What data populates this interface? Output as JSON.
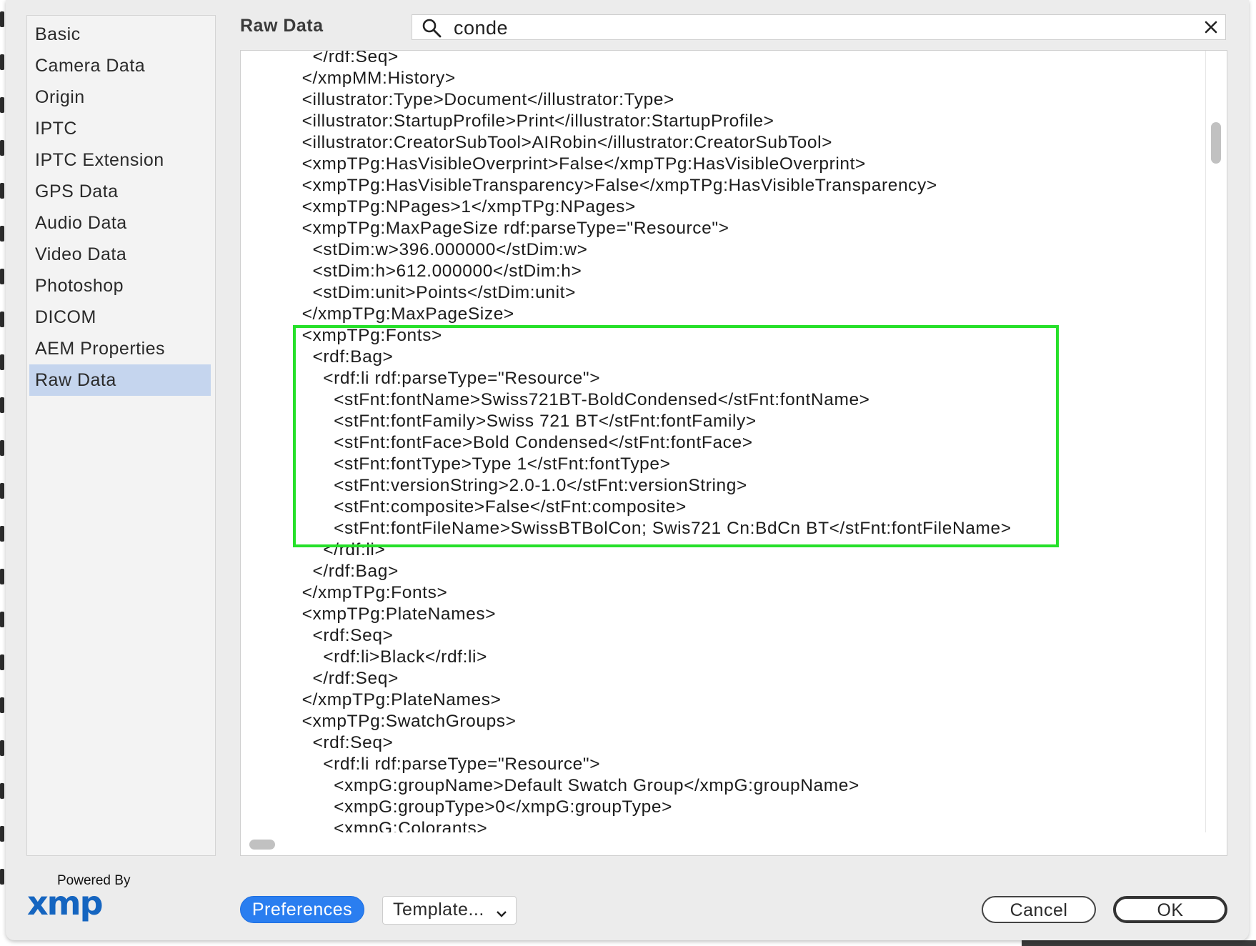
{
  "sidebar": {
    "items": [
      {
        "label": "Basic"
      },
      {
        "label": "Camera Data"
      },
      {
        "label": "Origin"
      },
      {
        "label": "IPTC"
      },
      {
        "label": "IPTC Extension"
      },
      {
        "label": "GPS Data"
      },
      {
        "label": "Audio Data"
      },
      {
        "label": "Video Data"
      },
      {
        "label": "Photoshop"
      },
      {
        "label": "DICOM"
      },
      {
        "label": "AEM Properties"
      },
      {
        "label": "Raw Data"
      }
    ],
    "active": "Raw Data"
  },
  "logo": {
    "powered_by": "Powered By",
    "brand": "xmp"
  },
  "header": {
    "title": "Raw Data"
  },
  "search": {
    "value": "conde",
    "icon": "search-icon",
    "clear_icon": "close-icon"
  },
  "raw_lines": [
    "      </rdf:Seq>",
    "    </xmpMM:History>",
    "    <illustrator:Type>Document</illustrator:Type>",
    "    <illustrator:StartupProfile>Print</illustrator:StartupProfile>",
    "    <illustrator:CreatorSubTool>AIRobin</illustrator:CreatorSubTool>",
    "    <xmpTPg:HasVisibleOverprint>False</xmpTPg:HasVisibleOverprint>",
    "    <xmpTPg:HasVisibleTransparency>False</xmpTPg:HasVisibleTransparency>",
    "    <xmpTPg:NPages>1</xmpTPg:NPages>",
    "    <xmpTPg:MaxPageSize rdf:parseType=\"Resource\">",
    "      <stDim:w>396.000000</stDim:w>",
    "      <stDim:h>612.000000</stDim:h>",
    "      <stDim:unit>Points</stDim:unit>",
    "    </xmpTPg:MaxPageSize>",
    "    <xmpTPg:Fonts>",
    "      <rdf:Bag>",
    "        <rdf:li rdf:parseType=\"Resource\">",
    "          <stFnt:fontName>Swiss721BT-BoldCondensed</stFnt:fontName>",
    "          <stFnt:fontFamily>Swiss 721 BT</stFnt:fontFamily>",
    "          <stFnt:fontFace>Bold Condensed</stFnt:fontFace>",
    "          <stFnt:fontType>Type 1</stFnt:fontType>",
    "          <stFnt:versionString>2.0-1.0</stFnt:versionString>",
    "          <stFnt:composite>False</stFnt:composite>",
    "          <stFnt:fontFileName>SwissBTBolCon; Swis721 Cn:BdCn BT</stFnt:fontFileName>",
    "        </rdf:li>",
    "      </rdf:Bag>",
    "    </xmpTPg:Fonts>",
    "    <xmpTPg:PlateNames>",
    "      <rdf:Seq>",
    "        <rdf:li>Black</rdf:li>",
    "      </rdf:Seq>",
    "    </xmpTPg:PlateNames>",
    "    <xmpTPg:SwatchGroups>",
    "      <rdf:Seq>",
    "        <rdf:li rdf:parseType=\"Resource\">",
    "          <xmpG:groupName>Default Swatch Group</xmpG:groupName>",
    "          <xmpG:groupType>0</xmpG:groupType>",
    "          <xmpG:Colorants>"
  ],
  "buttons": {
    "preferences": "Preferences",
    "template": "Template...",
    "cancel": "Cancel",
    "ok": "OK"
  },
  "colors": {
    "accent": "#2a7ef0",
    "selection": "#c5d5ee",
    "highlight_box": "#26e02a",
    "xmp_logo": "#1565c0"
  }
}
